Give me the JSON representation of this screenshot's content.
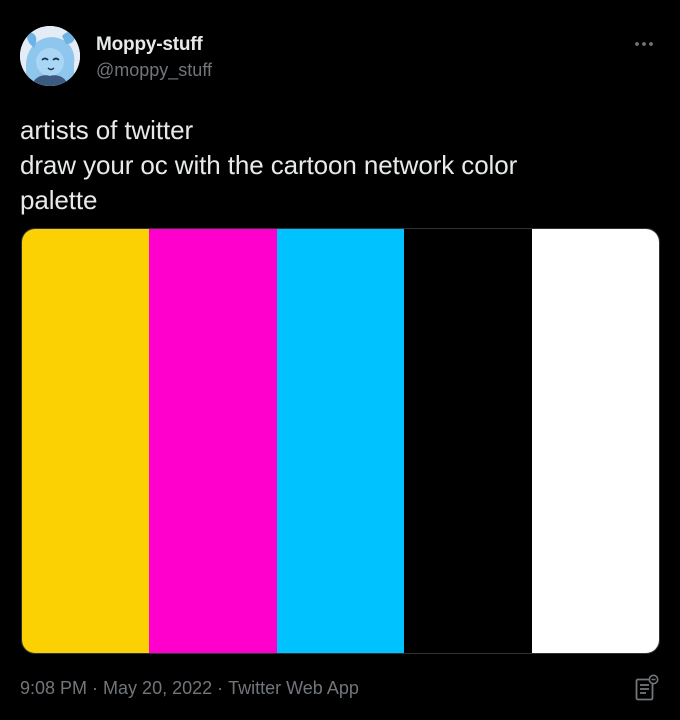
{
  "author": {
    "display_name": "Moppy-stuff",
    "handle": "@moppy_stuff"
  },
  "tweet": {
    "lines": [
      "artists of twitter",
      "draw your oc with the cartoon network color",
      "palette"
    ]
  },
  "media": {
    "swatches": [
      {
        "name": "yellow",
        "color": "#FBD103"
      },
      {
        "name": "magenta",
        "color": "#FF00CC"
      },
      {
        "name": "cyan",
        "color": "#00C2FF"
      },
      {
        "name": "black",
        "color": "#000000"
      },
      {
        "name": "white",
        "color": "#FFFFFF"
      }
    ]
  },
  "meta": {
    "time": "9:08 PM",
    "separator": "·",
    "date": "May 20, 2022",
    "source": "Twitter Web App"
  },
  "icons": {
    "more": "more-horizontal-icon",
    "analytics": "view-analytics-icon"
  },
  "colors": {
    "background": "#000000",
    "primary_text": "#e7e9ea",
    "secondary_text": "#71767b",
    "border": "#2f3336"
  }
}
